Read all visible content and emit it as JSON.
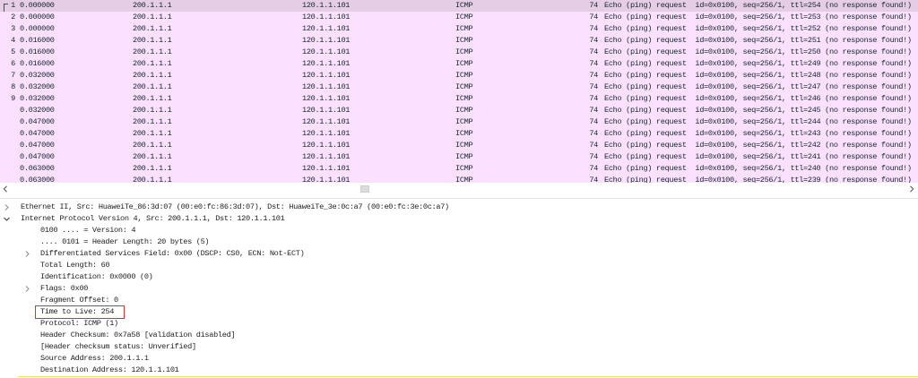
{
  "colors": {
    "icmp_row_bg": "#fce0ff",
    "icmp_row_fg": "#12272e",
    "selected_row_bg": "#e6cde6",
    "highlight_box": "#e0302a",
    "focus_line": "#efdf6c"
  },
  "packet_list": {
    "rows": [
      {
        "no": "1",
        "time": "0.000000",
        "source": "200.1.1.1",
        "destination": "120.1.1.101",
        "protocol": "ICMP",
        "length": "74",
        "info": "Echo (ping) request  id=0x0100, seq=256/1, ttl=254 (no response found!)",
        "selected": true,
        "related_icon": "related-packet-icon"
      },
      {
        "no": "2",
        "time": "0.000000",
        "source": "200.1.1.1",
        "destination": "120.1.1.101",
        "protocol": "ICMP",
        "length": "74",
        "info": "Echo (ping) request  id=0x0100, seq=256/1, ttl=253 (no response found!)"
      },
      {
        "no": "3",
        "time": "0.000000",
        "source": "200.1.1.1",
        "destination": "120.1.1.101",
        "protocol": "ICMP",
        "length": "74",
        "info": "Echo (ping) request  id=0x0100, seq=256/1, ttl=252 (no response found!)"
      },
      {
        "no": "4",
        "time": "0.016000",
        "source": "200.1.1.1",
        "destination": "120.1.1.101",
        "protocol": "ICMP",
        "length": "74",
        "info": "Echo (ping) request  id=0x0100, seq=256/1, ttl=251 (no response found!)"
      },
      {
        "no": "5",
        "time": "0.016000",
        "source": "200.1.1.1",
        "destination": "120.1.1.101",
        "protocol": "ICMP",
        "length": "74",
        "info": "Echo (ping) request  id=0x0100, seq=256/1, ttl=250 (no response found!)"
      },
      {
        "no": "6",
        "time": "0.016000",
        "source": "200.1.1.1",
        "destination": "120.1.1.101",
        "protocol": "ICMP",
        "length": "74",
        "info": "Echo (ping) request  id=0x0100, seq=256/1, ttl=249 (no response found!)"
      },
      {
        "no": "7",
        "time": "0.032000",
        "source": "200.1.1.1",
        "destination": "120.1.1.101",
        "protocol": "ICMP",
        "length": "74",
        "info": "Echo (ping) request  id=0x0100, seq=256/1, ttl=248 (no response found!)"
      },
      {
        "no": "8",
        "time": "0.032000",
        "source": "200.1.1.1",
        "destination": "120.1.1.101",
        "protocol": "ICMP",
        "length": "74",
        "info": "Echo (ping) request  id=0x0100, seq=256/1, ttl=247 (no response found!)"
      },
      {
        "no": "9",
        "time": "0.032000",
        "source": "200.1.1.1",
        "destination": "120.1.1.101",
        "protocol": "ICMP",
        "length": "74",
        "info": "Echo (ping) request  id=0x0100, seq=256/1, ttl=246 (no response found!)"
      },
      {
        "time": "0.032000",
        "source": "200.1.1.1",
        "destination": "120.1.1.101",
        "protocol": "ICMP",
        "length": "74",
        "info": "Echo (ping) request  id=0x0100, seq=256/1, ttl=245 (no response found!)"
      },
      {
        "time": "0.047000",
        "source": "200.1.1.1",
        "destination": "120.1.1.101",
        "protocol": "ICMP",
        "length": "74",
        "info": "Echo (ping) request  id=0x0100, seq=256/1, ttl=244 (no response found!)"
      },
      {
        "time": "0.047000",
        "source": "200.1.1.1",
        "destination": "120.1.1.101",
        "protocol": "ICMP",
        "length": "74",
        "info": "Echo (ping) request  id=0x0100, seq=256/1, ttl=243 (no response found!)"
      },
      {
        "time": "0.047000",
        "source": "200.1.1.1",
        "destination": "120.1.1.101",
        "protocol": "ICMP",
        "length": "74",
        "info": "Echo (ping) request  id=0x0100, seq=256/1, ttl=242 (no response found!)"
      },
      {
        "time": "0.047000",
        "source": "200.1.1.1",
        "destination": "120.1.1.101",
        "protocol": "ICMP",
        "length": "74",
        "info": "Echo (ping) request  id=0x0100, seq=256/1, ttl=241 (no response found!)"
      },
      {
        "time": "0.063000",
        "source": "200.1.1.1",
        "destination": "120.1.1.101",
        "protocol": "ICMP",
        "length": "74",
        "info": "Echo (ping) request  id=0x0100, seq=256/1, ttl=240 (no response found!)"
      },
      {
        "time": "0.063000",
        "source": "200.1.1.1",
        "destination": "120.1.1.101",
        "protocol": "ICMP",
        "length": "74",
        "info": "Echo (ping) request  id=0x0100, seq=256/1, ttl=239 (no response found!)"
      }
    ]
  },
  "scrollbar": {
    "left_icon": "chevron-left-icon",
    "right_icon": "chevron-right-icon"
  },
  "details": {
    "tree": [
      {
        "label": "Ethernet II, Src: HuaweiTe_86:3d:07 (00:e0:fc:86:3d:07), Dst: HuaweiTe_3e:0c:a7 (00:e0:fc:3e:0c:a7)",
        "expanded": false,
        "icon": "chevron-right-icon"
      },
      {
        "label": "Internet Protocol Version 4, Src: 200.1.1.1, Dst: 120.1.1.101",
        "expanded": true,
        "icon": "chevron-down-icon",
        "children": [
          {
            "label": "0100 .... = Version: 4"
          },
          {
            "label": ".... 0101 = Header Length: 20 bytes (5)"
          },
          {
            "label": "Differentiated Services Field: 0x00 (DSCP: CS0, ECN: Not-ECT)",
            "expanded": false,
            "icon": "chevron-right-icon"
          },
          {
            "label": "Total Length: 60"
          },
          {
            "label": "Identification: 0x0000 (0)"
          },
          {
            "label": "Flags: 0x00",
            "expanded": false,
            "icon": "chevron-right-icon"
          },
          {
            "label": "Fragment Offset: 0"
          },
          {
            "label": "Time to Live: 254",
            "highlighted": true
          },
          {
            "label": "Protocol: ICMP (1)"
          },
          {
            "label": "Header Checksum: 0x7a58 [validation disabled]"
          },
          {
            "label": "[Header checksum status: Unverified]"
          },
          {
            "label": "Source Address: 200.1.1.1"
          },
          {
            "label": "Destination Address: 120.1.1.101"
          }
        ]
      }
    ]
  }
}
